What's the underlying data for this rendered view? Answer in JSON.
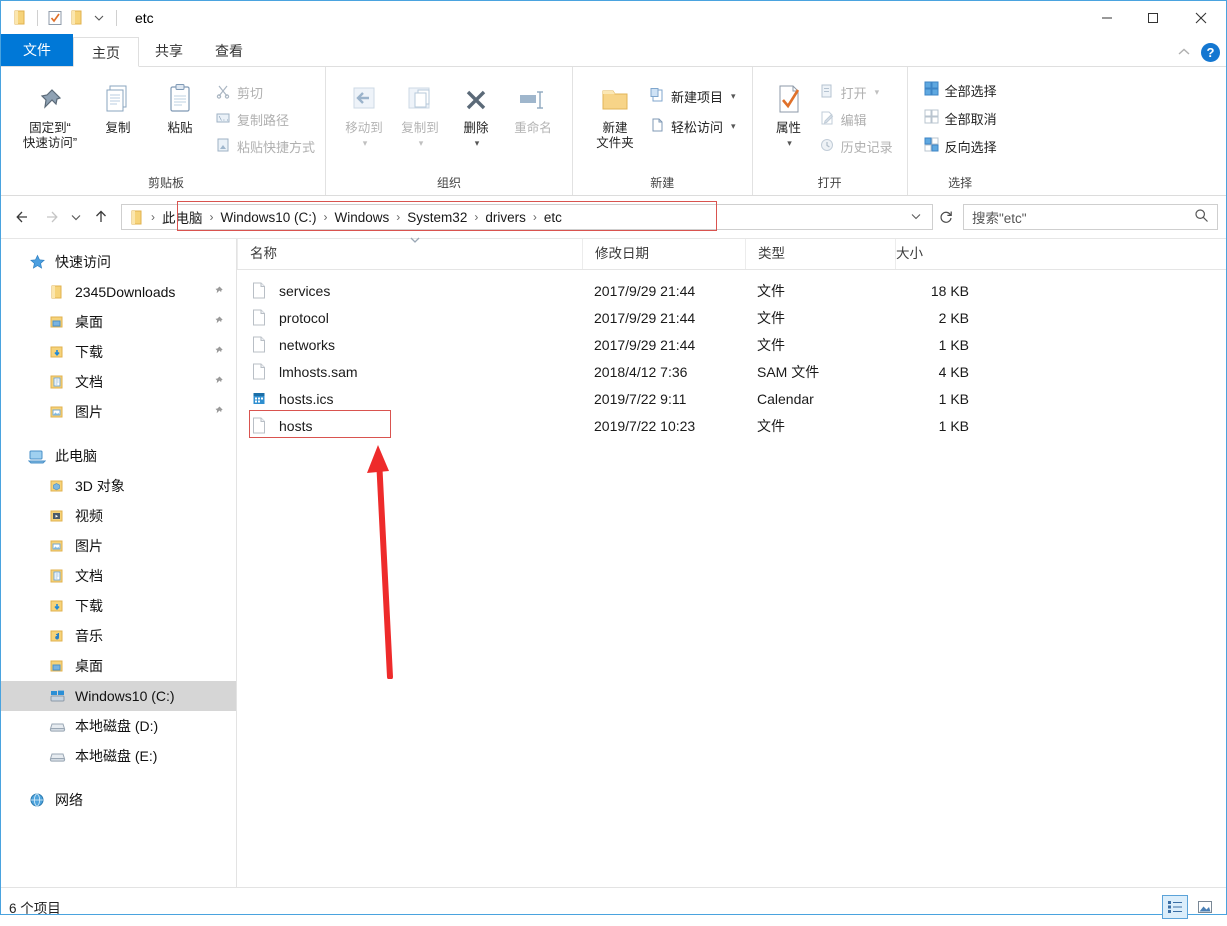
{
  "window": {
    "title": "etc",
    "quick_access_icons": [
      "folder-icon",
      "properties-checkbox-icon",
      "new-folder-icon",
      "customize-chevron-icon"
    ],
    "controls": {
      "minimize": "—",
      "maximize": "□",
      "close": "✕"
    }
  },
  "tabs": [
    {
      "id": "file",
      "label": "文件"
    },
    {
      "id": "home",
      "label": "主页"
    },
    {
      "id": "share",
      "label": "共享"
    },
    {
      "id": "view",
      "label": "查看"
    }
  ],
  "ribbon": {
    "help_label": "?",
    "groups": [
      {
        "id": "clipboard",
        "label": "剪贴板",
        "big": [
          {
            "id": "pin-to-quick-access",
            "label": "固定到“\n快速访问”",
            "line1": "固定到“",
            "line2": "快速访问”",
            "icon": "pin-icon"
          },
          {
            "id": "copy",
            "line1": "复制",
            "line2": "",
            "icon": "copy-icon"
          },
          {
            "id": "paste",
            "line1": "粘贴",
            "line2": "",
            "icon": "paste-icon"
          }
        ],
        "small": [
          {
            "id": "cut",
            "label": "剪切",
            "icon": "scissors-icon",
            "disabled": true
          },
          {
            "id": "copy-path",
            "label": "复制路径",
            "icon": "copy-path-icon",
            "disabled": true
          },
          {
            "id": "paste-shortcut",
            "label": "粘贴快捷方式",
            "icon": "paste-shortcut-icon",
            "disabled": true
          }
        ]
      },
      {
        "id": "organize",
        "label": "组织",
        "big": [
          {
            "id": "move-to",
            "line1": "移动到",
            "line2": "",
            "icon": "move-to-icon",
            "disabled": true,
            "caret": true
          },
          {
            "id": "copy-to",
            "line1": "复制到",
            "line2": "",
            "icon": "copy-to-icon",
            "disabled": true,
            "caret": true
          },
          {
            "id": "delete",
            "line1": "删除",
            "line2": "",
            "icon": "delete-icon",
            "caret": true
          },
          {
            "id": "rename",
            "line1": "重命名",
            "line2": "",
            "icon": "rename-icon",
            "disabled": true
          }
        ],
        "small": []
      },
      {
        "id": "new",
        "label": "新建",
        "big": [
          {
            "id": "new-folder",
            "line1": "新建",
            "line2": "文件夹",
            "icon": "new-folder-icon"
          }
        ],
        "small": [
          {
            "id": "new-item",
            "label": "新建项目",
            "icon": "new-item-icon",
            "caret": true
          },
          {
            "id": "easy-access",
            "label": "轻松访问",
            "icon": "easy-access-icon",
            "caret": true
          }
        ]
      },
      {
        "id": "open",
        "label": "打开",
        "big": [
          {
            "id": "properties",
            "line1": "属性",
            "line2": "",
            "icon": "properties-icon",
            "caret": true
          }
        ],
        "small": [
          {
            "id": "open",
            "label": "打开",
            "icon": "open-icon",
            "disabled": true,
            "caret": true
          },
          {
            "id": "edit",
            "label": "编辑",
            "icon": "edit-icon",
            "disabled": true
          },
          {
            "id": "history",
            "label": "历史记录",
            "icon": "history-icon",
            "disabled": true
          }
        ]
      },
      {
        "id": "select",
        "label": "选择",
        "big": [],
        "small": [
          {
            "id": "select-all",
            "label": "全部选择",
            "icon": "select-all-icon"
          },
          {
            "id": "select-none",
            "label": "全部取消",
            "icon": "select-none-icon"
          },
          {
            "id": "invert-selection",
            "label": "反向选择",
            "icon": "invert-selection-icon"
          }
        ]
      }
    ]
  },
  "address": {
    "back_icon": "back-arrow-icon",
    "forward_icon": "forward-arrow-icon",
    "recent_icon": "chevron-down-icon",
    "up_icon": "up-arrow-icon",
    "refresh_icon": "refresh-icon",
    "breadcrumb": [
      "此电脑",
      "Windows10 (C:)",
      "Windows",
      "System32",
      "drivers",
      "etc"
    ],
    "dropdown_icon": "chevron-down-icon"
  },
  "search": {
    "placeholder": "搜索\"etc\"",
    "icon": "search-icon"
  },
  "sidebar": {
    "sections": [
      {
        "id": "quick-access",
        "label": "快速访问",
        "icon": "star-icon",
        "items": [
          {
            "label": "2345Downloads",
            "icon": "folder-icon",
            "pinned": true
          },
          {
            "label": "桌面",
            "icon": "desktop-folder-icon",
            "pinned": true
          },
          {
            "label": "下载",
            "icon": "downloads-folder-icon",
            "pinned": true
          },
          {
            "label": "文档",
            "icon": "documents-folder-icon",
            "pinned": true
          },
          {
            "label": "图片",
            "icon": "pictures-folder-icon",
            "pinned": true
          }
        ]
      },
      {
        "id": "this-pc",
        "label": "此电脑",
        "icon": "computer-icon",
        "items": [
          {
            "label": "3D 对象",
            "icon": "3d-objects-icon"
          },
          {
            "label": "视频",
            "icon": "videos-folder-icon"
          },
          {
            "label": "图片",
            "icon": "pictures-folder-icon"
          },
          {
            "label": "文档",
            "icon": "documents-folder-icon"
          },
          {
            "label": "下载",
            "icon": "downloads-folder-icon"
          },
          {
            "label": "音乐",
            "icon": "music-folder-icon"
          },
          {
            "label": "桌面",
            "icon": "desktop-folder-icon"
          },
          {
            "label": "Windows10 (C:)",
            "icon": "windows-drive-icon",
            "selected": true
          },
          {
            "label": "本地磁盘 (D:)",
            "icon": "drive-icon"
          },
          {
            "label": "本地磁盘 (E:)",
            "icon": "drive-icon"
          }
        ]
      },
      {
        "id": "network",
        "label": "网络",
        "icon": "network-icon",
        "items": []
      }
    ]
  },
  "filelist": {
    "columns": [
      "名称",
      "修改日期",
      "类型",
      "大小"
    ],
    "sort_indicator": "chevron-down-icon",
    "rows": [
      {
        "name": "services",
        "icon": "file-icon",
        "date": "2017/9/29 21:44",
        "type": "文件",
        "size": "18 KB"
      },
      {
        "name": "protocol",
        "icon": "file-icon",
        "date": "2017/9/29 21:44",
        "type": "文件",
        "size": "2 KB"
      },
      {
        "name": "networks",
        "icon": "file-icon",
        "date": "2017/9/29 21:44",
        "type": "文件",
        "size": "1 KB"
      },
      {
        "name": "lmhosts.sam",
        "icon": "file-icon",
        "date": "2018/4/12 7:36",
        "type": "SAM 文件",
        "size": "4 KB"
      },
      {
        "name": "hosts.ics",
        "icon": "calendar-icon",
        "date": "2019/7/22 9:11",
        "type": "Calendar",
        "size": "1 KB"
      },
      {
        "name": "hosts",
        "icon": "file-icon",
        "date": "2019/7/22 10:23",
        "type": "文件",
        "size": "1 KB",
        "highlighted": true
      }
    ]
  },
  "annotation": {
    "arrow_color": "#ee2b2b",
    "highlight_color": "#d9534f",
    "target": "hosts"
  },
  "statusbar": {
    "item_count": "6 个项目",
    "views": [
      {
        "id": "details-view",
        "icon": "details-view-icon",
        "active": true
      },
      {
        "id": "large-icons-view",
        "icon": "large-icons-view-icon",
        "active": false
      }
    ]
  }
}
